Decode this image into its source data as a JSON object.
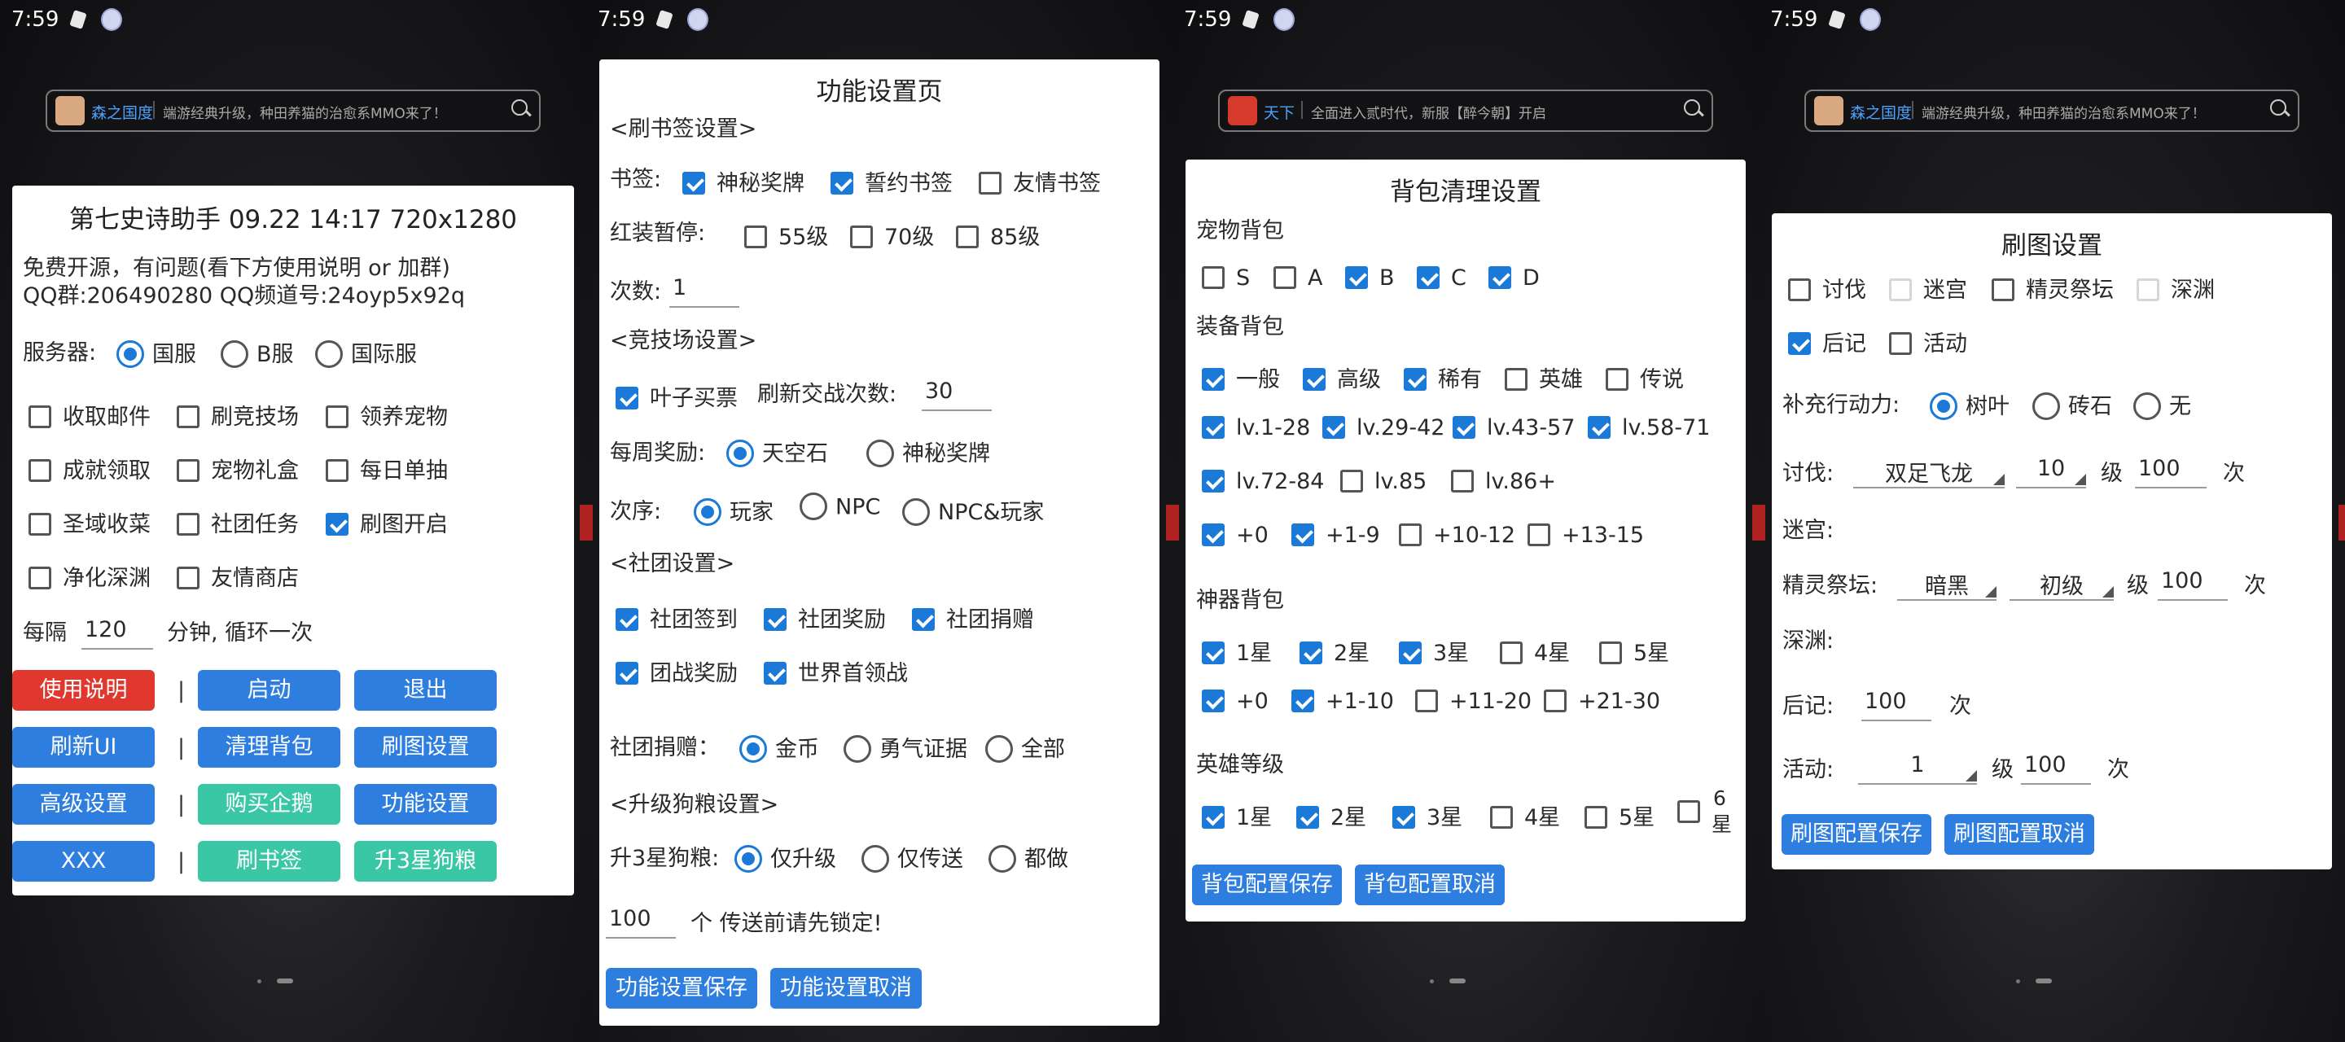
{
  "status": {
    "time": "7:59"
  },
  "ads": [
    {
      "name": "森之国度",
      "text": "端游经典升级，种田养猫的治愈系MMO来了！"
    },
    {
      "name": "天下",
      "text": "全面进入贰时代，新服【醉今朝】开启"
    }
  ],
  "screen1": {
    "title": "第七史诗助手 09.22 14:17 720x1280",
    "info1": "免费开源，有问题(看下方使用说明 or 加群)",
    "info2": "QQ群:206490280      QQ频道号:24oyp5x92q",
    "server_label": "服务器:",
    "servers": [
      "国服",
      "B服",
      "国际服"
    ],
    "options": [
      "收取邮件",
      "刷竞技场",
      "领养宠物",
      "成就领取",
      "宠物礼盒",
      "每日单抽",
      "圣域收菜",
      "社团任务",
      "刷图开启",
      "净化深渊",
      "友情商店"
    ],
    "interval_prefix": "每隔",
    "interval_value": "120",
    "interval_suffix": "分钟, 循环一次",
    "pipe": "|",
    "buttons": {
      "manual": "使用说明",
      "start": "启动",
      "exit": "退出",
      "refresh": "刷新UI",
      "clear_bag": "清理背包",
      "map_settings": "刷图设置",
      "advanced": "高级设置",
      "buy_penguin": "购买企鹅",
      "func_settings": "功能设置",
      "xxx": "XXX",
      "bookmarks": "刷书签",
      "dog_food": "升3星狗粮"
    }
  },
  "screen2": {
    "title": "功能设置页",
    "bookmark_header": "<刷书签设置>",
    "bookmark_label": "书签:",
    "bookmarks": [
      "神秘奖牌",
      "誓约书签",
      "友情书签"
    ],
    "redpause_label": "红装暂停:",
    "redpause": [
      "55级",
      "70级",
      "85级"
    ],
    "count_label": "次数:",
    "count_value": "1",
    "arena_header": "<竞技场设置>",
    "leaf_buy": "叶子买票",
    "refresh_label": "刷新交战次数:",
    "refresh_value": "30",
    "weekly_label": "每周奖励:",
    "weekly": [
      "天空石",
      "神秘奖牌"
    ],
    "order_label": "次序:",
    "order": [
      "玩家",
      "NPC",
      "NPC&玩家"
    ],
    "guild_header": "<社团设置>",
    "guild_opts": [
      "社团签到",
      "社团奖励",
      "社团捐赠",
      "团战奖励",
      "世界首领战"
    ],
    "donate_label": "社团捐赠：",
    "donate": [
      "金币",
      "勇气证据",
      "全部"
    ],
    "dog_header": "<升级狗粮设置>",
    "upgrade_label": "升3星狗粮:",
    "upgrade": [
      "仅升级",
      "仅传送",
      "都做"
    ],
    "amount_value": "100",
    "amount_suffix": "个  传送前请先锁定!",
    "save": "功能设置保存",
    "cancel": "功能设置取消"
  },
  "screen3": {
    "title": "背包清理设置",
    "pet_label": "宠物背包",
    "pet": [
      "S",
      "A",
      "B",
      "C",
      "D"
    ],
    "equip_label": "装备背包",
    "equip_grade": [
      "一般",
      "高级",
      "稀有",
      "英雄",
      "传说"
    ],
    "equip_lv1": [
      "lv.1-28",
      "lv.29-42",
      "lv.43-57",
      "lv.58-71"
    ],
    "equip_lv2": [
      "lv.72-84",
      "lv.85",
      "lv.86+"
    ],
    "equip_plus": [
      "+0",
      "+1-9",
      "+10-12",
      "+13-15"
    ],
    "art_label": "神器背包",
    "art_star": [
      "1星",
      "2星",
      "3星",
      "4星",
      "5星"
    ],
    "art_plus": [
      "+0",
      "+1-10",
      "+11-20",
      "+21-30"
    ],
    "hero_label": "英雄等级",
    "hero": [
      "1星",
      "2星",
      "3星",
      "4星",
      "5星"
    ],
    "hero_six_a": "6",
    "hero_six_b": "星",
    "save": "背包配置保存",
    "cancel": "背包配置取消"
  },
  "screen4": {
    "title": "刷图设置",
    "modes": [
      "讨伐",
      "迷宫",
      "精灵祭坛",
      "深渊",
      "后记",
      "活动"
    ],
    "refill_label": "补充行动力:",
    "refill": [
      "树叶",
      "砖石",
      "无"
    ],
    "hunt_label": "讨伐:",
    "hunt_boss": "双足飞龙",
    "hunt_level": "10",
    "level_word": "级",
    "hunt_count": "100",
    "times_word": "次",
    "maze_label": "迷宫:",
    "altar_label": "精灵祭坛:",
    "altar_type": "暗黑",
    "altar_level": "初级",
    "altar_count": "100",
    "abyss_label": "深渊:",
    "epilogue_label": "后记:",
    "epilogue_count": "100",
    "event_label": "活动:",
    "event_level": "1",
    "event_count": "100",
    "save": "刷图配置保存",
    "cancel": "刷图配置取消"
  }
}
